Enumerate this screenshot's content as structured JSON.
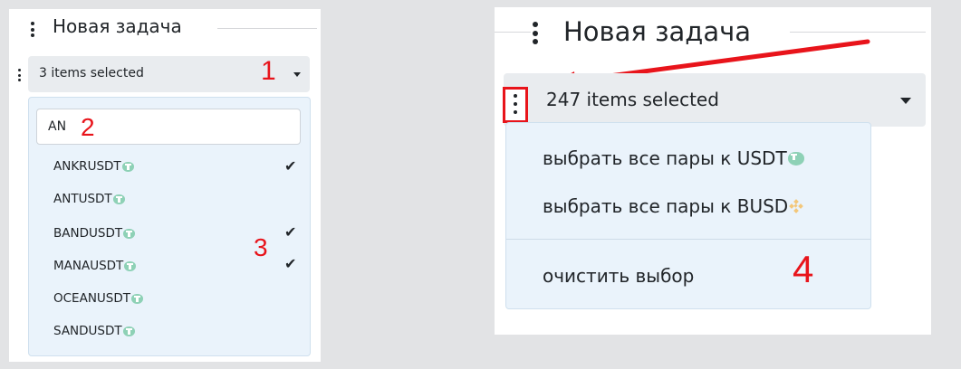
{
  "left": {
    "title": "Новая задача",
    "select_label": "3 items selected",
    "search_value": "AN",
    "options": [
      {
        "label": "ANKRUSDT",
        "icon": "tether-icon",
        "checked": true
      },
      {
        "label": "ANTUSDT",
        "icon": "tether-icon",
        "checked": false
      },
      {
        "label": "BANDUSDT",
        "icon": "tether-icon",
        "checked": true
      },
      {
        "label": "MANAUSDT",
        "icon": "tether-icon",
        "checked": true
      },
      {
        "label": "OCEANUSDT",
        "icon": "tether-icon",
        "checked": false
      },
      {
        "label": "SANDUSDT",
        "icon": "tether-icon",
        "checked": false
      }
    ],
    "annotations": {
      "n1": "1",
      "n2": "2",
      "n3": "3"
    }
  },
  "right": {
    "title": "Новая задача",
    "select_label": "247 items selected",
    "menu": {
      "select_usdt": "выбрать все пары к USDT",
      "select_busd": "выбрать все пары к BUSD",
      "clear": "очистить выбор"
    },
    "annotations": {
      "n4": "4"
    }
  },
  "colors": {
    "annotation_red": "#e8141b",
    "tether": "#8ed1b6",
    "binance": "#f3c77a",
    "dropdown_bg": "#eaf3fb"
  }
}
